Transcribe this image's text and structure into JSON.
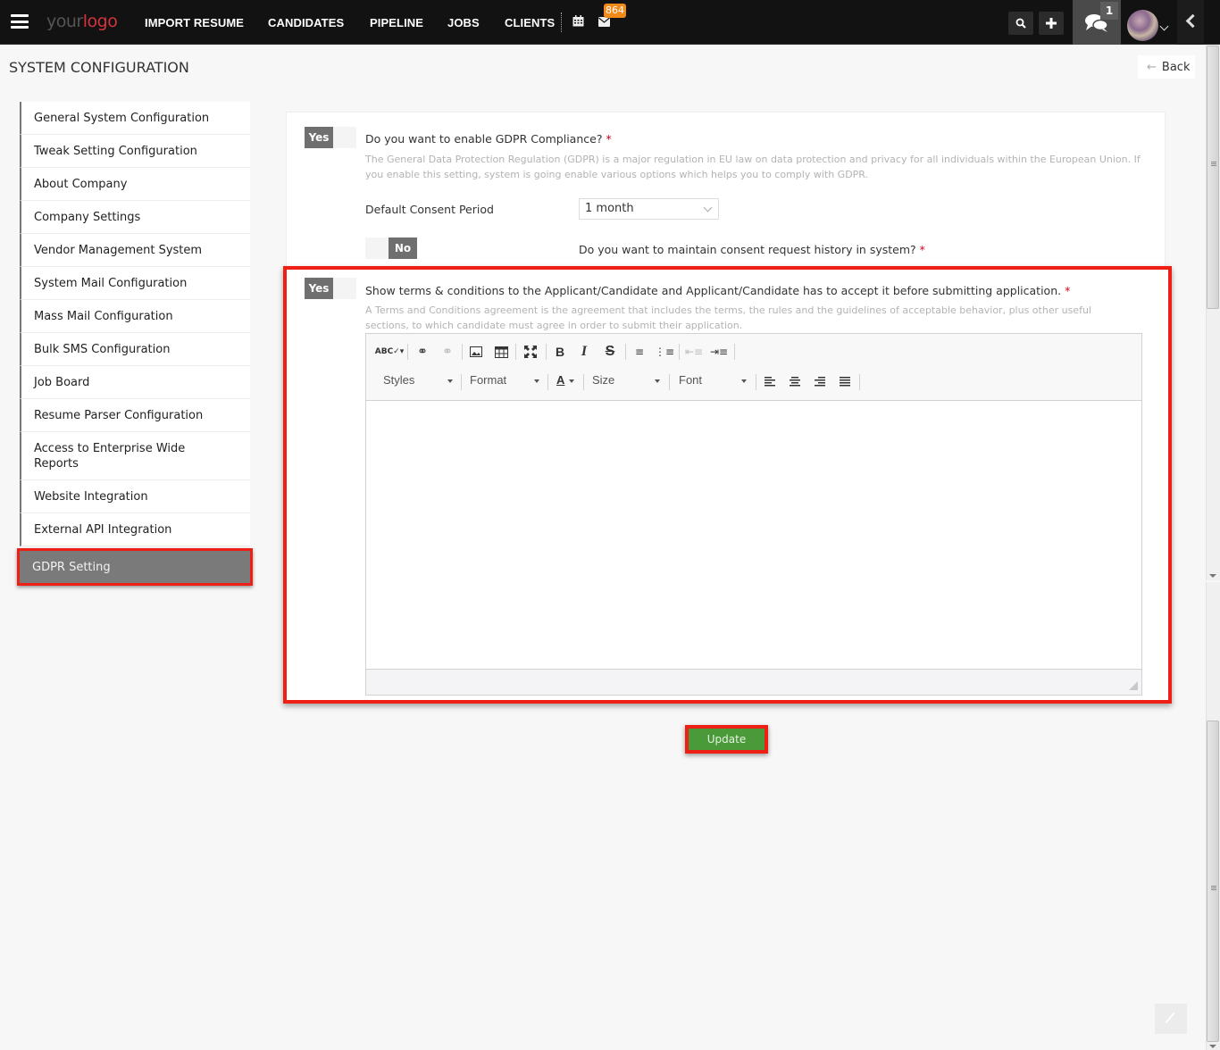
{
  "topbar": {
    "logo_part1": "your",
    "logo_part2": "logo",
    "nav": [
      "IMPORT RESUME",
      "CANDIDATES",
      "PIPELINE",
      "JOBS",
      "CLIENTS"
    ],
    "mail_badge": "864",
    "chat_count": "1",
    "icons": [
      "hamburger-icon",
      "calendar-icon",
      "mail-icon",
      "search-icon",
      "plus-icon",
      "chat-icon",
      "avatar",
      "chevron-left-icon"
    ]
  },
  "page": {
    "title": "SYSTEM CONFIGURATION",
    "back_label": "Back"
  },
  "sidebar": {
    "items": [
      "General System Configuration",
      "Tweak Setting Configuration",
      "About Company",
      "Company Settings",
      "Vendor Management System",
      "System Mail Configuration",
      "Mass Mail Configuration",
      "Bulk SMS Configuration",
      "Job Board",
      "Resume Parser Configuration",
      "Access to Enterprise Wide Reports",
      "Website Integration",
      "External API Integration",
      "GDPR Setting"
    ],
    "active": "GDPR Setting"
  },
  "gdpr": {
    "enable": {
      "toggle_value": "Yes",
      "label": "Do you want to enable GDPR Compliance?",
      "required": "*",
      "help": "The General Data Protection Regulation (GDPR) is a major regulation in EU law on data protection and privacy for all individuals within the European Union. If you enable this setting, system is going enable various options which helps you to comply with GDPR."
    },
    "consent_period": {
      "label": "Default Consent Period",
      "value": "1 month"
    },
    "history": {
      "toggle_value": "No",
      "label": "Do you want to maintain consent request history in system?",
      "required": "*"
    },
    "terms": {
      "toggle_value": "Yes",
      "label": "Show terms & conditions to the Applicant/Candidate and Applicant/Candidate has to accept it before submitting application.",
      "required": "*",
      "help": "A Terms and Conditions agreement is the agreement that includes the terms, the rules and the guidelines of acceptable behavior, plus other useful sections, to which candidate must agree in order to submit their application."
    }
  },
  "editor": {
    "toolbar_row1": [
      "spellcheck",
      "link",
      "unlink",
      "image",
      "table",
      "maximize",
      "bold",
      "italic",
      "strikethrough",
      "numbered-list",
      "bulleted-list",
      "outdent",
      "indent"
    ],
    "combos": {
      "styles": "Styles",
      "format": "Format",
      "size": "Size",
      "font": "Font"
    },
    "text_color_glyph": "A",
    "align": [
      "align-left",
      "align-center",
      "align-right",
      "justify"
    ],
    "content": ""
  },
  "actions": {
    "update_label": "Update"
  }
}
